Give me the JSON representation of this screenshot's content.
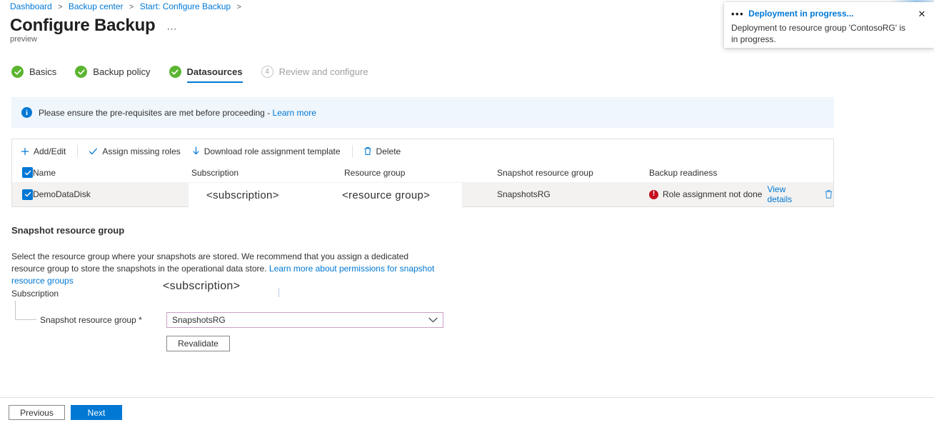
{
  "breadcrumb": {
    "items": [
      "Dashboard",
      "Backup center",
      "Start: Configure Backup"
    ],
    "separator": ">"
  },
  "header": {
    "title": "Configure Backup",
    "ellipsis": "⋯",
    "preview_label": "preview"
  },
  "steps": [
    {
      "label": "Basics",
      "state": "done"
    },
    {
      "label": "Backup policy",
      "state": "done"
    },
    {
      "label": "Datasources",
      "state": "active-done"
    },
    {
      "label": "Review and configure",
      "state": "pending",
      "number": "4"
    }
  ],
  "info_banner": {
    "icon": "info-icon",
    "text": "Please ensure the pre-requisites are met before proceeding - ",
    "link": "Learn more"
  },
  "toolbar": {
    "add_edit": "Add/Edit",
    "assign_roles": "Assign missing roles",
    "download_template": "Download role assignment template",
    "delete": "Delete"
  },
  "table": {
    "columns": [
      "Name",
      "Subscription",
      "Resource group",
      "Snapshot resource group",
      "Backup readiness"
    ],
    "header_checkbox_checked": true,
    "rows": [
      {
        "checked": true,
        "name": "DemoDataDisk",
        "subscription": "<subscription>",
        "resource_group": "<resource group>",
        "snapshot_resource_group": "SnapshotsRG",
        "readiness": "Role assignment not done",
        "readiness_state": "error",
        "view_details": "View details",
        "delete_icon": "trash-icon"
      }
    ]
  },
  "section": {
    "title": "Snapshot resource group",
    "description": "Select the resource group where your snapshots are stored. We recommend that you assign a dedicated resource group to store the snapshots in the operational data store. ",
    "description_link": "Learn more about permissions for snapshot resource groups"
  },
  "form": {
    "subscription_label": "Subscription",
    "subscription_value": "<subscription>",
    "snapshot_rg_label": "Snapshot resource group *",
    "snapshot_rg_value": "SnapshotsRG",
    "revalidate_label": "Revalidate"
  },
  "footer": {
    "previous": "Previous",
    "next": "Next"
  },
  "toast": {
    "title": "Deployment in progress...",
    "body": "Deployment to resource group 'ContosoRG' is in progress.",
    "close": "✕"
  },
  "colors": {
    "accent": "#0078d4",
    "success": "#5cb531",
    "error": "#c50f1f",
    "dropdown_border": "#c9a0c9",
    "row_selected": "#f3f2f1",
    "banner_bg": "#eff6fc"
  }
}
